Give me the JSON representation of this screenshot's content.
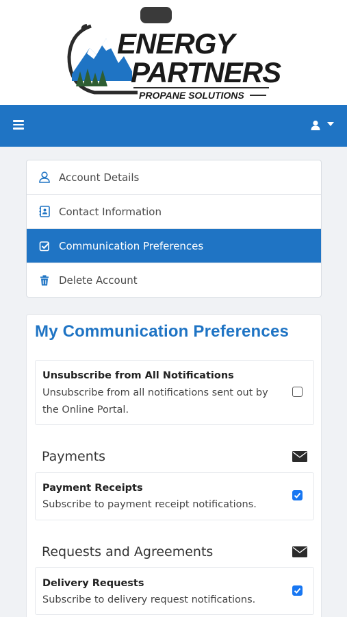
{
  "logo": {
    "line1": "ENERGY",
    "line2": "PARTNERS",
    "tagline": "PROPANE SOLUTIONS",
    "colors": {
      "mountain_blue": "#1f74c4",
      "tree_green": "#2e5e33",
      "text_dark": "#1a1a1a"
    }
  },
  "topbar": {
    "background": "#1f74c4",
    "menu_icon": "hamburger-icon",
    "user_icon": "user-icon"
  },
  "side_menu": {
    "items": [
      {
        "label": "Account Details",
        "icon": "user-outline-icon",
        "active": false
      },
      {
        "label": "Contact Information",
        "icon": "contact-card-icon",
        "active": false
      },
      {
        "label": "Communication Preferences",
        "icon": "check-square-icon",
        "active": true
      },
      {
        "label": "Delete Account",
        "icon": "trash-icon",
        "active": false
      }
    ]
  },
  "preferences": {
    "title": "My Communication Preferences",
    "unsubscribe": {
      "title": "Unsubscribe from All Notifications",
      "desc_line1": "Unsubscribe from all notifications sent out by",
      "desc_line2": "the Online Portal.",
      "checked": false
    },
    "sections": [
      {
        "heading": "Payments",
        "items": [
          {
            "title": "Payment Receipts",
            "desc": "Subscribe to payment receipt notifications.",
            "checked": true
          }
        ]
      },
      {
        "heading": "Requests and Agreements",
        "items": [
          {
            "title": "Delivery Requests",
            "desc": "Subscribe to delivery request notifications.",
            "checked": true
          }
        ]
      }
    ]
  }
}
